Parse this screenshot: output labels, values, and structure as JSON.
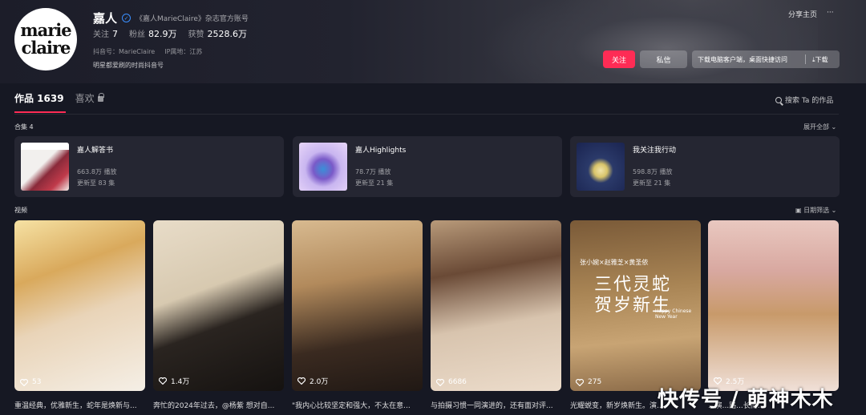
{
  "profile": {
    "avatar_line1": "marie",
    "avatar_line2": "claire",
    "name": "嘉人",
    "certification": "《嘉人MarieClaire》杂志官方账号",
    "following_label": "关注",
    "following": "7",
    "followers_label": "粉丝",
    "followers": "82.9万",
    "likes_label": "获赞",
    "likes": "2528.6万",
    "douyin_id": "抖音号：MarieClaire",
    "ip_location": "IP属地：江苏",
    "bio": "明星都爱刷的时尚抖音号"
  },
  "header_actions": {
    "share": "分享主页",
    "more": "···",
    "follow": "关注",
    "message": "私信",
    "download_prompt": "下载电脑客户端，桌面快捷访问",
    "download": "下载"
  },
  "tabs": {
    "works": "作品 1639",
    "likes": "喜欢",
    "search": "搜索 Ta 的作品"
  },
  "collections": {
    "label": "合集 4",
    "expand": "展开全部",
    "items": [
      {
        "title": "嘉人解答书",
        "plays": "663.8万 播放",
        "updated": "更新至 83 集"
      },
      {
        "title": "嘉人Highlights",
        "plays": "78.7万 播放",
        "updated": "更新至 21 集"
      },
      {
        "title": "我关注我行动",
        "plays": "598.8万 播放",
        "updated": "更新至 21 集"
      }
    ]
  },
  "videos": {
    "label": "视频",
    "filter": "日期筛选",
    "items": [
      {
        "likes": "53",
        "title": "重温经典，优雅新生，蛇年是焕新与..."
      },
      {
        "likes": "1.4万",
        "title": "奔忙的2024年过去，@杨紫 想对自..."
      },
      {
        "likes": "2.0万",
        "title": "\"我内心比较坚定和强大，不太在意..."
      },
      {
        "likes": "6686",
        "title": "与拍摄习惯一同演进的，还有面对评..."
      },
      {
        "likes": "275",
        "title": "光耀蜕变，新岁焕新生。演...",
        "overlay_line1": "张小婉×赵雅芝×黄圣依",
        "overlay_line2": "三代灵蛇",
        "overlay_line3": "贺岁新生",
        "overlay_en": "Happy Chinese New Year"
      },
      {
        "likes": "2.5万",
        "title": "...演...路...长而..."
      }
    ]
  },
  "watermark": "快传号 / 萌神木木",
  "colors": {
    "accent": "#fe2c55",
    "background": "#161823",
    "card": "#252632",
    "verify": "#3a8fff"
  },
  "icons": [
    "verify-icon",
    "lock-icon",
    "search-icon",
    "chevron-down-icon",
    "calendar-icon",
    "heart-icon",
    "download-icon"
  ]
}
